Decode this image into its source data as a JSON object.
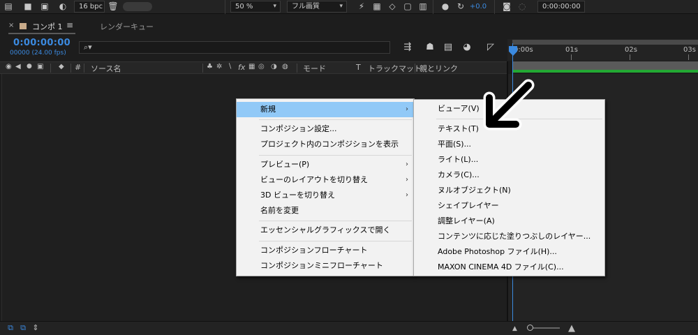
{
  "toolbar": {
    "bit_depth": "16 bpc",
    "zoom": "50 %",
    "resolution": "フル画質",
    "exposure": "+0.0",
    "timecode": "0:00:00:00"
  },
  "panel": {
    "close_glyph": "×",
    "tab_name": "コンポ 1",
    "menu_glyph": "≡",
    "render_queue_tab": "レンダーキュー",
    "swatch_color": "#c8ab8a"
  },
  "timecode": {
    "main": "0:00:00:00",
    "frames": "00000 (24.00 fps)",
    "color": "#3b8ae0"
  },
  "search": {
    "placeholder": ""
  },
  "ruler": {
    "labels": [
      "0:00s",
      "01s",
      "02s",
      "03s"
    ]
  },
  "columns": {
    "number": "#",
    "source_name": "ソース名",
    "switches": "fx",
    "mode": "モード",
    "t": "T",
    "track_matte": "トラックマット",
    "parent_link": "親とリンク"
  },
  "context_menu": {
    "items": [
      {
        "label": "新規",
        "submenu": true,
        "highlighted": true
      },
      {
        "label": "コンポジション設定..."
      },
      {
        "label": "プロジェクト内のコンポジションを表示"
      },
      {
        "label": "プレビュー(P)",
        "submenu": true
      },
      {
        "label": "ビューのレイアウトを切り替え",
        "submenu": true
      },
      {
        "label": "3D ビューを切り替え",
        "submenu": true
      },
      {
        "label": "名前を変更"
      },
      {
        "label": "エッセンシャルグラフィックスで開く"
      },
      {
        "label": "コンポジションフローチャート"
      },
      {
        "label": "コンポジションミニフローチャート"
      }
    ],
    "submenu_glyph": "›"
  },
  "new_submenu": {
    "items": [
      {
        "label": "ビューア(V)"
      },
      {
        "label": "テキスト(T)"
      },
      {
        "label": "平面(S)..."
      },
      {
        "label": "ライト(L)..."
      },
      {
        "label": "カメラ(C)..."
      },
      {
        "label": "ヌルオブジェクト(N)"
      },
      {
        "label": "シェイプレイヤー"
      },
      {
        "label": "調整レイヤー(A)"
      },
      {
        "label": "コンテンツに応じた塗りつぶしのレイヤー..."
      },
      {
        "label": "Adobe Photoshop ファイル(H)..."
      },
      {
        "label": "MAXON CINEMA 4D ファイル(C)..."
      }
    ]
  },
  "colors": {
    "highlight": "#91c9f7",
    "work_area_bar": "#23a833",
    "playhead": "#3b8ae0"
  }
}
